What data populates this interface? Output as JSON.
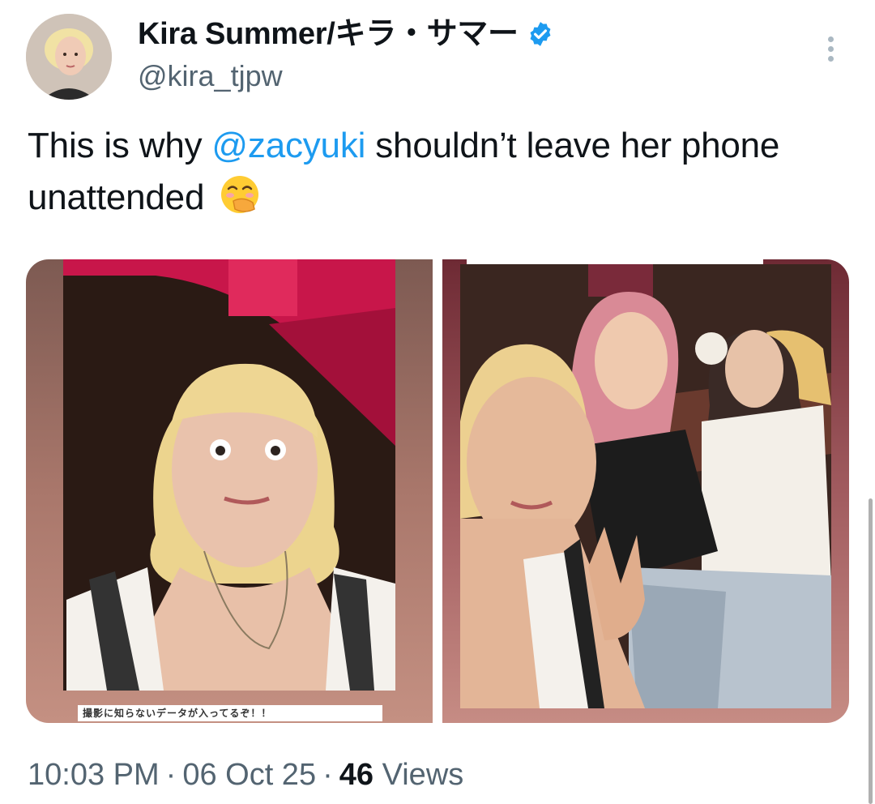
{
  "author": {
    "display_name": "Kira Summer/キラ・サマー",
    "handle": "@kira_tjpw",
    "verified": true,
    "avatar_icon": "profile-photo"
  },
  "tweet": {
    "text_before": "This is why ",
    "mention": "@zacyuki",
    "text_after": " shouldn’t leave her phone unattended ",
    "emoji": "face-with-hand-over-mouth"
  },
  "media": {
    "count": 2,
    "caption_left": "撮影に知らないデータが入ってるぞ！！"
  },
  "meta": {
    "time": "10:03 PM",
    "separator": "·",
    "date": "06 Oct 25",
    "views_count": "46",
    "views_label": "Views"
  },
  "colors": {
    "accent": "#1d9bf0",
    "muted": "#536471",
    "text": "#0f1419",
    "photo_frame": "#b27f72"
  }
}
